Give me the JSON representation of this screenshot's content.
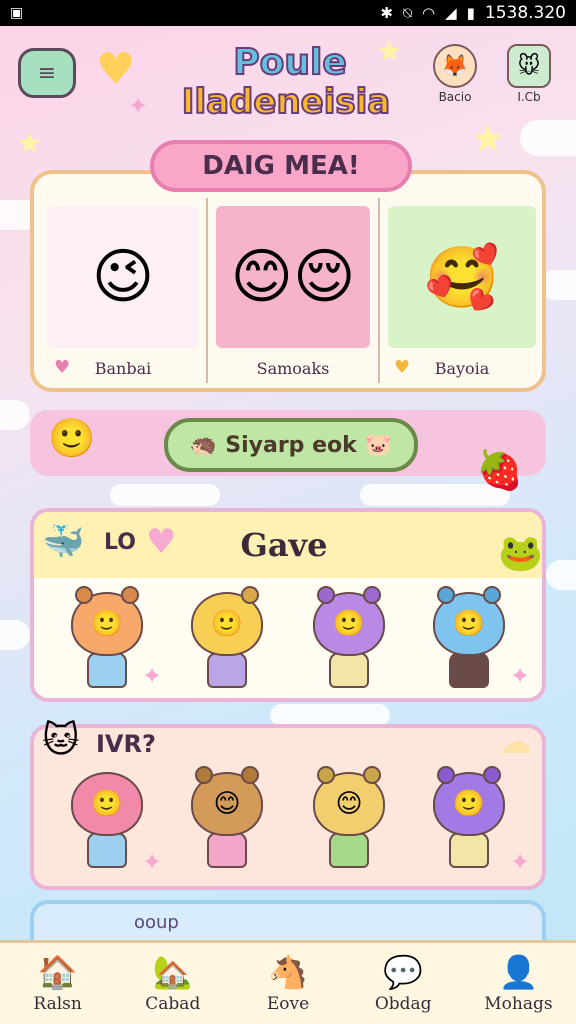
{
  "status_bar": {
    "time": "1538.320"
  },
  "header": {
    "title_line1": "Poule",
    "title_line2": "Iladeneisia",
    "profiles": [
      {
        "label": "Bacio",
        "face": "🦊",
        "color": "#f5a35a"
      },
      {
        "label": "I.Cb",
        "face": "🐭",
        "color": "#8ad0ea"
      }
    ]
  },
  "featured": {
    "title": "DAIG MEA!",
    "cells": [
      {
        "caption": "Banbai",
        "face": "😉",
        "bg": "#fdf0f4",
        "icon": "♥"
      },
      {
        "caption": "Samoaks",
        "face": "😊😌",
        "bg": "#f6b4cc",
        "icon": ""
      },
      {
        "caption": "Bayoia",
        "face": "🥰",
        "bg": "#d9f3c9",
        "icon": "♥"
      }
    ]
  },
  "action": {
    "label": "Siyarp eok",
    "left_icon": "🦔",
    "right_icon": "🐷"
  },
  "panel_1": {
    "label": "LO",
    "title": "Gave",
    "chars": [
      {
        "face": "🙂",
        "hair": "#f7a86b",
        "body": "#9bd0f0"
      },
      {
        "face": "🙂",
        "hair": "#f7cf55",
        "body": "#b8a6e6"
      },
      {
        "face": "🙂",
        "hair": "#b88ae6",
        "body": "#f2e6a6"
      },
      {
        "face": "🙂",
        "hair": "#7ec4ee",
        "body": "#6b4a4a"
      }
    ]
  },
  "panel_2": {
    "label": "IVR?",
    "chars": [
      {
        "face": "🙂",
        "hair": "#f08aa8",
        "body": "#9bd0f0"
      },
      {
        "face": "😊",
        "hair": "#d39a5a",
        "body": "#f2a6c9"
      },
      {
        "face": "😊",
        "hair": "#f2cf6e",
        "body": "#a6d98a"
      },
      {
        "face": "🙂",
        "hair": "#a27ae6",
        "body": "#f2e6a6"
      }
    ]
  },
  "peek": {
    "label": "ooup"
  },
  "bottom_nav": [
    {
      "label": "Ralsn",
      "icon": "🏠",
      "color": "#5cb85c"
    },
    {
      "label": "Cabad",
      "icon": "🏡",
      "color": "#e98ab6"
    },
    {
      "label": "Eove",
      "icon": "🐴",
      "color": "#f39ac0"
    },
    {
      "label": "Obdag",
      "icon": "💬",
      "color": "#7ec4ee"
    },
    {
      "label": "Mohags",
      "icon": "👤",
      "color": "#f2a53c"
    }
  ]
}
